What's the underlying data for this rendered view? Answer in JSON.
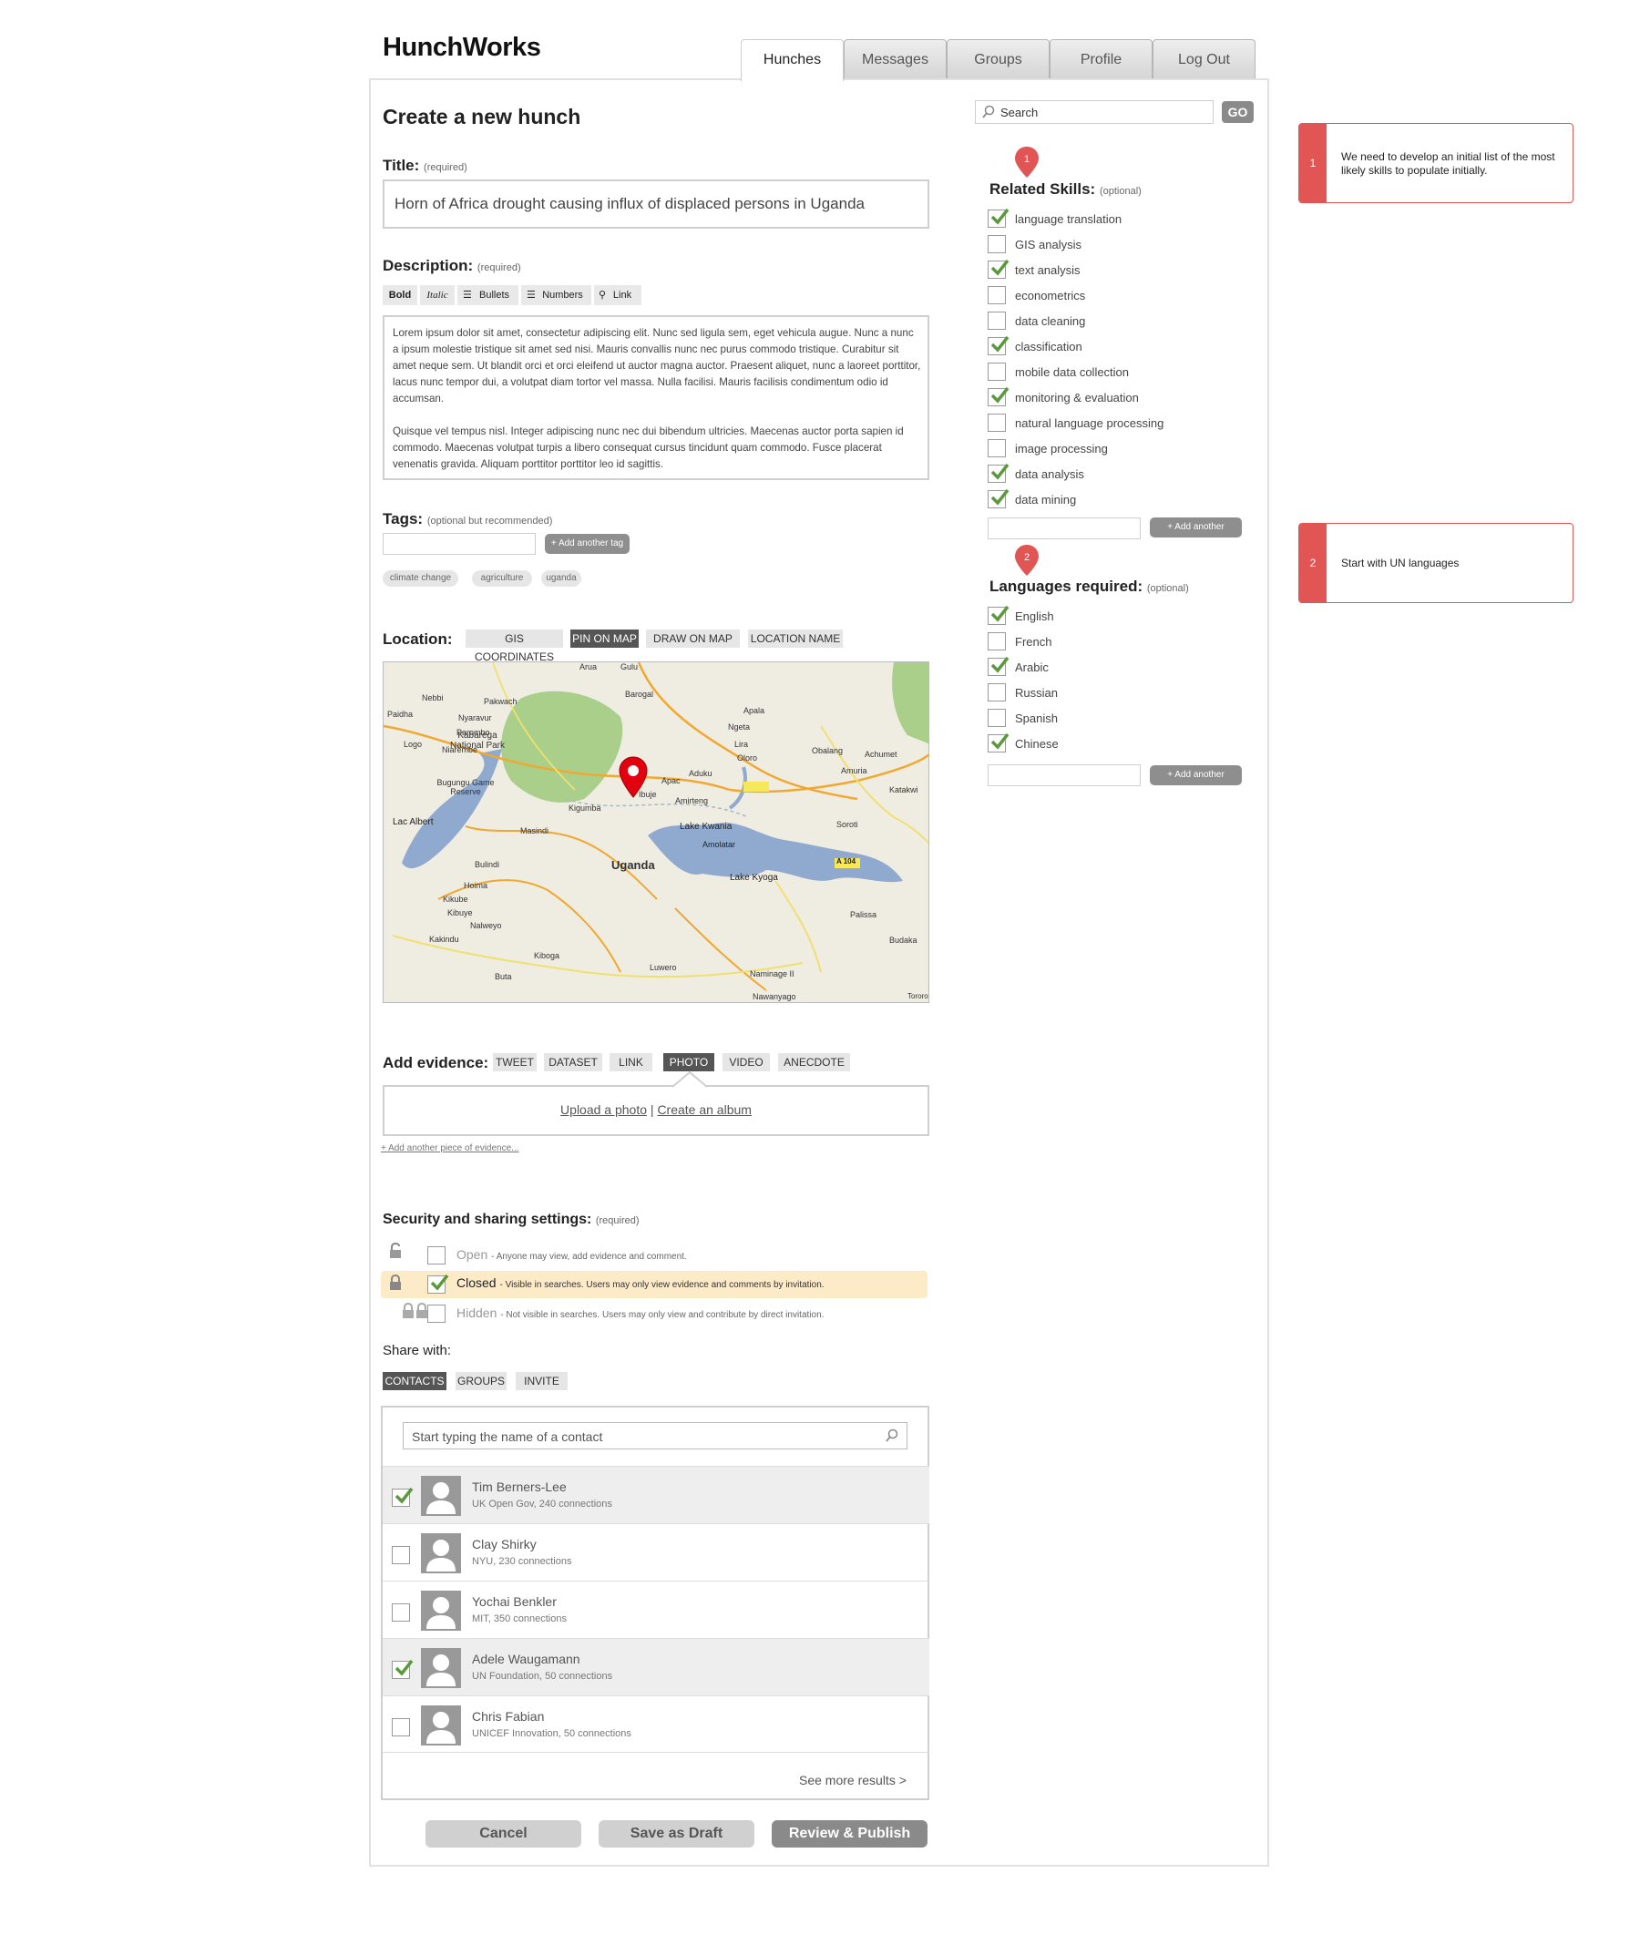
{
  "app": {
    "name": "HunchWorks"
  },
  "nav": {
    "tabs": [
      "Hunches",
      "Messages",
      "Groups",
      "Profile",
      "Log Out"
    ],
    "active": "Hunches"
  },
  "search": {
    "placeholder": "Search",
    "go": "GO"
  },
  "page": {
    "title": "Create a new hunch"
  },
  "title_field": {
    "label": "Title:",
    "note": "(required)",
    "value": "Horn of Africa drought causing influx of displaced persons in Uganda"
  },
  "description": {
    "label": "Description:",
    "note": "(required)",
    "toolbar": [
      "Bold",
      "Italic",
      "Bullets",
      "Numbers",
      "Link"
    ],
    "p1": "Lorem ipsum dolor sit amet, consectetur adipiscing elit. Nunc sed ligula sem, eget vehicula augue. Nunc a nunc a ipsum molestie tristique sit amet sed nisi. Mauris convallis nunc nec purus commodo tristique. Curabitur sit amet neque sem. Ut blandit orci et orci eleifend ut auctor magna auctor. Praesent aliquet, nunc a laoreet porttitor, lacus nunc tempor dui, a volutpat diam tortor vel massa. Nulla facilisi. Mauris facilisis condimentum odio id accumsan.",
    "p2": "Quisque vel tempus nisl. Integer adipiscing nunc nec dui bibendum ultricies. Maecenas auctor porta sapien id commodo. Maecenas volutpat turpis a libero consequat cursus tincidunt quam commodo. Fusce placerat venenatis gravida. Aliquam porttitor porttitor leo id sagittis."
  },
  "tags": {
    "label": "Tags:",
    "note": "(optional but recommended)",
    "add": "+ Add another tag",
    "items": [
      "climate change",
      "agriculture",
      "uganda"
    ]
  },
  "location": {
    "label": "Location:",
    "options": [
      "GIS COORDINATES",
      "PIN ON MAP",
      "DRAW ON MAP",
      "LOCATION NAME"
    ],
    "selected": "PIN ON MAP"
  },
  "map": {
    "labels": [
      "Arua",
      "Gulu",
      "Pakwach",
      "Nebbi",
      "Nyaravur",
      "Parombo",
      "Paidha",
      "Logo",
      "Niarembe",
      "Kabarega National Park",
      "Bugungu Game Reserve",
      "Lac Albert",
      "Barogal",
      "Apala",
      "Ngeta",
      "Lira",
      "Oloro",
      "Obalang",
      "Achumet",
      "Amuria",
      "Katakwi",
      "Apac",
      "Aduku",
      "Amirteng",
      "Ibuje",
      "Kigumba",
      "Masindi",
      "Lake Kwania",
      "Amolatar",
      "Lake Kyoga",
      "Uganda",
      "Bulindi",
      "Hoima",
      "Kikube",
      "Kibuye",
      "Nalweyo",
      "Kakindu",
      "Kiboga",
      "Buta",
      "Luwero",
      "Naminage II",
      "Nawanyago",
      "Palissa",
      "Budaka",
      "Soroti",
      "A 104",
      "Tororo"
    ]
  },
  "evidence": {
    "label": "Add evidence:",
    "options": [
      "TWEET",
      "DATASET",
      "LINK",
      "PHOTO",
      "VIDEO",
      "ANECDOTE"
    ],
    "selected": "PHOTO",
    "upload": "Upload a photo",
    "sep": "|",
    "album": "Create an album",
    "add_more": "+ Add another piece of evidence..."
  },
  "security": {
    "label": "Security and sharing settings:",
    "note": "(required)",
    "options": [
      {
        "name": "Open",
        "desc": "- Anyone may view, add evidence and comment.",
        "checked": false
      },
      {
        "name": "Closed",
        "desc": "- Visible in searches. Users may only view evidence and comments by invitation.",
        "checked": true
      },
      {
        "name": "Hidden",
        "desc": "- Not visible in searches. Users may only view and contribute by direct invitation.",
        "checked": false
      }
    ]
  },
  "share": {
    "label": "Share with:",
    "tabs": [
      "CONTACTS",
      "GROUPS",
      "INVITE"
    ],
    "selected": "CONTACTS",
    "placeholder": "Start typing the name of a contact",
    "contacts": [
      {
        "name": "Tim Berners-Lee",
        "meta": "UK Open Gov, 240 connections",
        "checked": true
      },
      {
        "name": "Clay Shirky",
        "meta": "NYU, 230 connections",
        "checked": false
      },
      {
        "name": "Yochai Benkler",
        "meta": "MIT, 350 connections",
        "checked": false
      },
      {
        "name": "Adele Waugamann",
        "meta": "UN Foundation, 50 connections",
        "checked": true
      },
      {
        "name": "Chris Fabian",
        "meta": "UNICEF Innovation, 50 connections",
        "checked": false
      }
    ],
    "more": "See more results >"
  },
  "actions": {
    "cancel": "Cancel",
    "draft": "Save as Draft",
    "publish": "Review & Publish"
  },
  "skills": {
    "label": "Related Skills:",
    "note": "(optional)",
    "add": "+ Add another",
    "items": [
      {
        "name": "language translation",
        "checked": true
      },
      {
        "name": "GIS analysis",
        "checked": false
      },
      {
        "name": "text analysis",
        "checked": true
      },
      {
        "name": "econometrics",
        "checked": false
      },
      {
        "name": "data cleaning",
        "checked": false
      },
      {
        "name": "classification",
        "checked": true
      },
      {
        "name": "mobile data collection",
        "checked": false
      },
      {
        "name": "monitoring & evaluation",
        "checked": true
      },
      {
        "name": "natural language processing",
        "checked": false
      },
      {
        "name": "image processing",
        "checked": false
      },
      {
        "name": "data analysis",
        "checked": true
      },
      {
        "name": "data mining",
        "checked": true
      }
    ]
  },
  "languages": {
    "label": "Languages required:",
    "note": "(optional)",
    "add": "+ Add another",
    "items": [
      {
        "name": "English",
        "checked": true
      },
      {
        "name": "French",
        "checked": false
      },
      {
        "name": "Arabic",
        "checked": true
      },
      {
        "name": "Russian",
        "checked": false
      },
      {
        "name": "Spanish",
        "checked": false
      },
      {
        "name": "Chinese",
        "checked": true
      }
    ]
  },
  "annotations": [
    {
      "num": "1",
      "text": "We need to develop an initial list of the most likely skills to populate initially."
    },
    {
      "num": "2",
      "text": "Start with UN languages"
    }
  ],
  "colors": {
    "accent": "#e15555",
    "check": "#5a9a3a",
    "selected_tab": "#555555",
    "closed_highlight": "#fdebc8"
  }
}
